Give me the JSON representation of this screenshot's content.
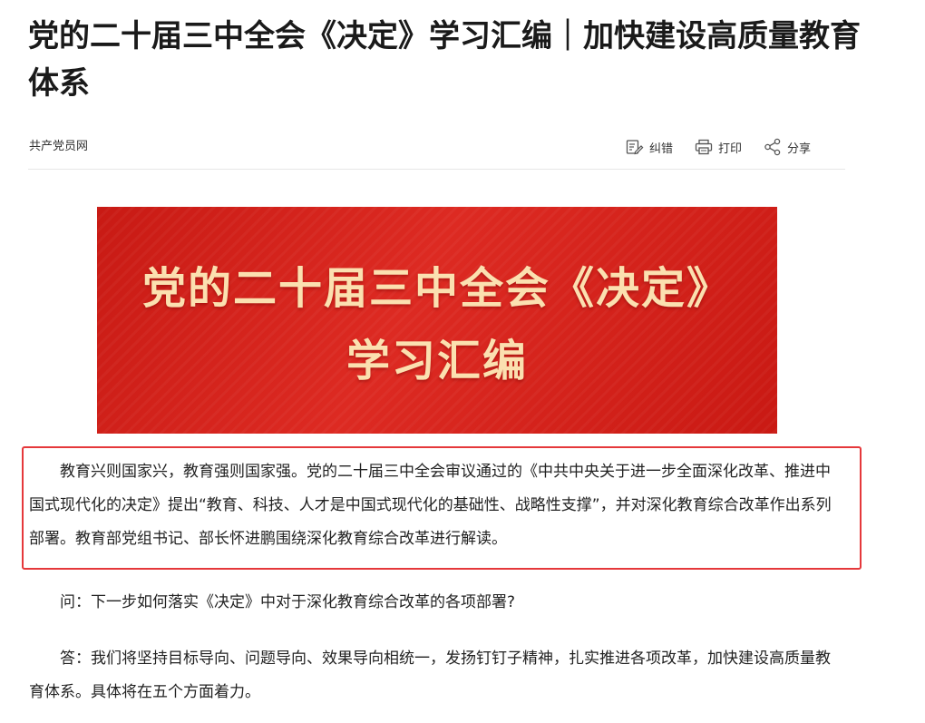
{
  "article": {
    "title": "党的二十届三中全会《决定》学习汇编｜加快建设高质量教育体系",
    "source": "共产党员网"
  },
  "toolbar": {
    "correct_label": "纠错",
    "print_label": "打印",
    "share_label": "分享"
  },
  "banner": {
    "line1": "党的二十届三中全会《决定》",
    "line2": "学习汇编"
  },
  "paragraphs": [
    "教育兴则国家兴，教育强则国家强。党的二十届三中全会审议通过的《中共中央关于进一步全面深化改革、推进中国式现代化的决定》提出“教育、科技、人才是中国式现代化的基础性、战略性支撑”，并对深化教育综合改革作出系列部署。教育部党组书记、部长怀进鹏围绕深化教育综合改革进行解读。",
    "问：下一步如何落实《决定》中对于深化教育综合改革的各项部署?",
    "答：我们将坚持目标导向、问题导向、效果导向相统一，发扬钉钉子精神，扎实推进各项改革，加快建设高质量教育体系。具体将在五个方面着力。"
  ],
  "colors": {
    "banner_red": "#d42319",
    "banner_text": "#fbe0b0",
    "highlight_border": "#e5383b"
  },
  "icons": [
    "edit-icon",
    "printer-icon",
    "share-icon"
  ]
}
